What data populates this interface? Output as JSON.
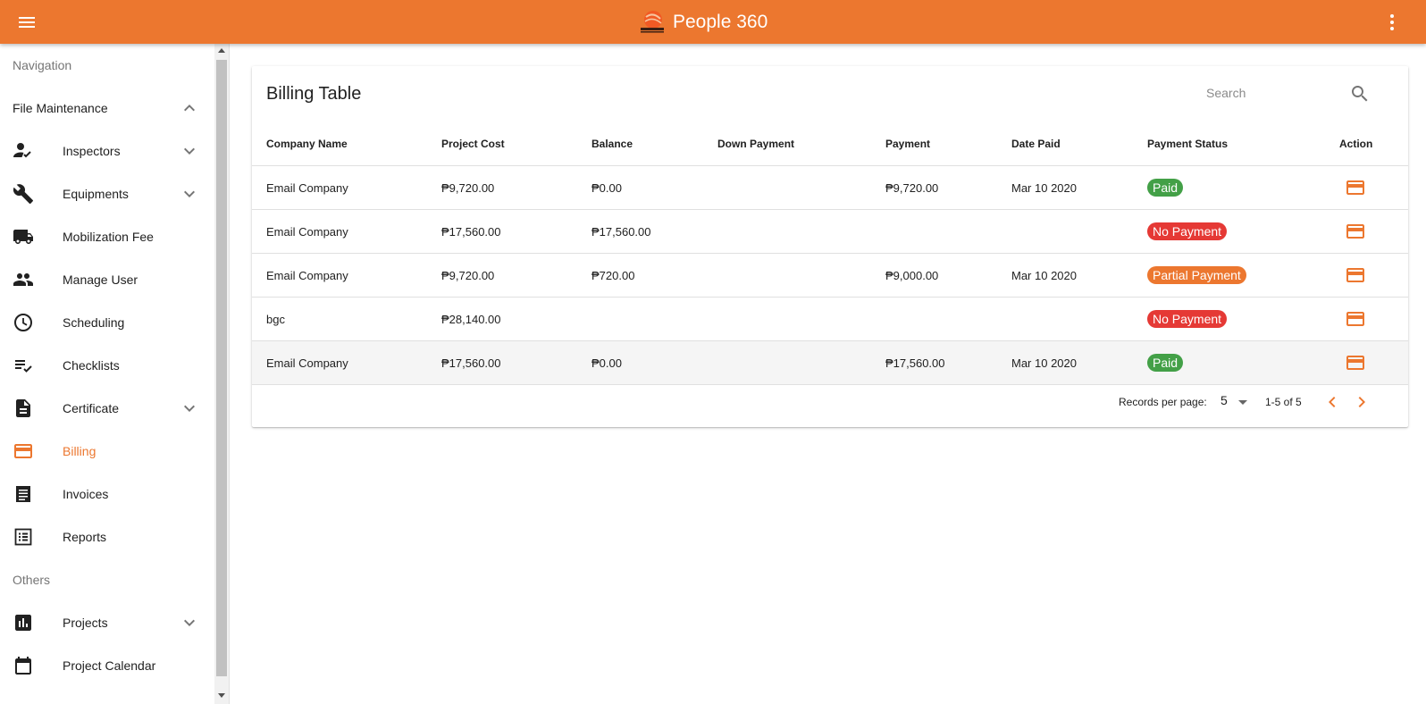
{
  "app": {
    "title": "People 360"
  },
  "colors": {
    "accent": "#ec772f",
    "paid": "#43a047",
    "no_payment": "#e53935",
    "partial": "#ec772f"
  },
  "sidebar": {
    "navigation_header": "Navigation",
    "file_maintenance": "File Maintenance",
    "items": [
      {
        "label": "Inspectors",
        "icon": "person-check-icon"
      },
      {
        "label": "Equipments",
        "icon": "wrench-icon"
      },
      {
        "label": "Mobilization Fee",
        "icon": "truck-icon"
      },
      {
        "label": "Manage User",
        "icon": "people-icon"
      },
      {
        "label": "Scheduling",
        "icon": "clock-icon"
      },
      {
        "label": "Checklists",
        "icon": "checklist-icon"
      },
      {
        "label": "Certificate",
        "icon": "document-icon"
      },
      {
        "label": "Billing",
        "icon": "credit-card-icon"
      },
      {
        "label": "Invoices",
        "icon": "receipt-icon"
      },
      {
        "label": "Reports",
        "icon": "list-icon"
      }
    ],
    "others_header": "Others",
    "others_items": [
      {
        "label": "Projects",
        "icon": "bar-chart-icon"
      },
      {
        "label": "Project Calendar",
        "icon": "calendar-icon"
      }
    ]
  },
  "billing": {
    "title": "Billing Table",
    "search_placeholder": "Search",
    "columns": [
      "Company Name",
      "Project Cost",
      "Balance",
      "Down Payment",
      "Payment",
      "Date Paid",
      "Payment Status",
      "Action"
    ],
    "rows": [
      {
        "company": "Email Company",
        "cost": "₱9,720.00",
        "balance": "₱0.00",
        "down": "",
        "payment": "₱9,720.00",
        "date": "Mar 10 2020",
        "status": "Paid"
      },
      {
        "company": "Email Company",
        "cost": "₱17,560.00",
        "balance": "₱17,560.00",
        "down": "",
        "payment": "",
        "date": "",
        "status": "No Payment"
      },
      {
        "company": "Email Company",
        "cost": "₱9,720.00",
        "balance": "₱720.00",
        "down": "",
        "payment": "₱9,000.00",
        "date": "Mar 10 2020",
        "status": "Partial Payment"
      },
      {
        "company": "bgc",
        "cost": "₱28,140.00",
        "balance": "",
        "down": "",
        "payment": "",
        "date": "",
        "status": "No Payment"
      },
      {
        "company": "Email Company",
        "cost": "₱17,560.00",
        "balance": "₱0.00",
        "down": "",
        "payment": "₱17,560.00",
        "date": "Mar 10 2020",
        "status": "Paid"
      }
    ],
    "footer": {
      "records_per_page_label": "Records per page:",
      "records_per_page": "5",
      "range": "1-5 of 5"
    }
  }
}
